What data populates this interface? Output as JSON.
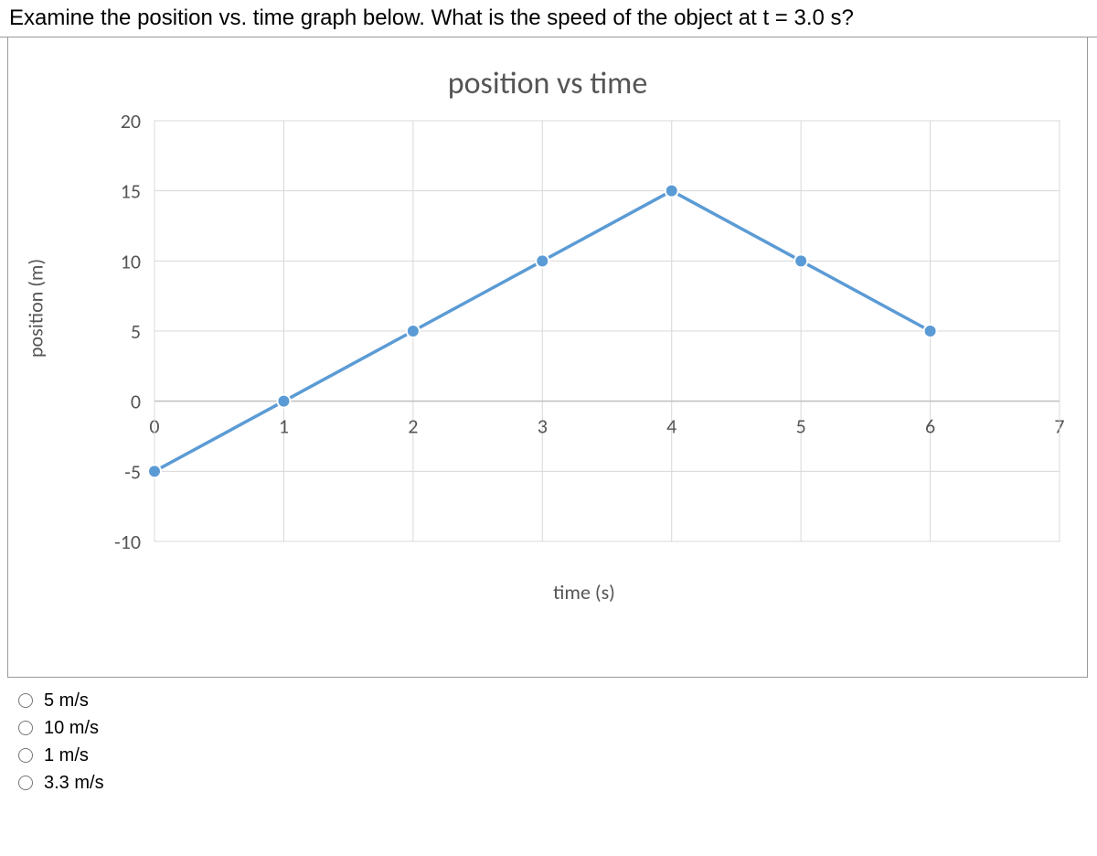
{
  "question_text": "Examine the position vs. time graph below. What is the speed of the object at t = 3.0 s?",
  "chart_data": {
    "type": "line",
    "title": "position vs time",
    "xlabel": "time (s)",
    "ylabel": "position (m)",
    "x": [
      0,
      1,
      2,
      3,
      4,
      5,
      6
    ],
    "y": [
      -5,
      0,
      5,
      10,
      15,
      10,
      5
    ],
    "x_ticks": [
      0,
      1,
      2,
      3,
      4,
      5,
      6,
      7
    ],
    "y_ticks": [
      -10,
      -5,
      0,
      5,
      10,
      15,
      20
    ],
    "xlim": [
      0,
      7
    ],
    "ylim": [
      -10,
      20
    ]
  },
  "options": [
    {
      "label": "5 m/s"
    },
    {
      "label": "10 m/s"
    },
    {
      "label": "1 m/s"
    },
    {
      "label": "3.3 m/s"
    }
  ]
}
